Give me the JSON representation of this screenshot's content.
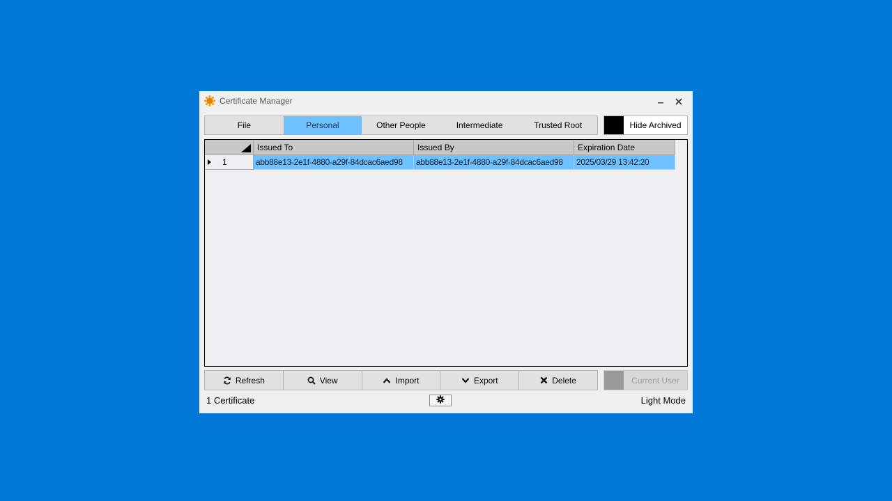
{
  "window": {
    "title": "Certificate Manager"
  },
  "tabs": [
    {
      "label": "File",
      "active": false
    },
    {
      "label": "Personal",
      "active": true
    },
    {
      "label": "Other People",
      "active": false
    },
    {
      "label": "Intermediate",
      "active": false
    },
    {
      "label": "Trusted Root",
      "active": false
    }
  ],
  "hide_archived": {
    "label": "Hide Archived"
  },
  "grid": {
    "columns": [
      "Issued To",
      "Issued By",
      "Expiration Date"
    ],
    "rows": [
      {
        "index": "1",
        "issued_to": "abb88e13-2e1f-4880-a29f-84dcac6aed98",
        "issued_by": "abb88e13-2e1f-4880-a29f-84dcac6aed98",
        "expiration": "2025/03/29 13:42:20"
      }
    ]
  },
  "actions": {
    "refresh": {
      "label": "Refresh",
      "icon": "refresh-icon"
    },
    "view": {
      "label": "View",
      "icon": "search-icon"
    },
    "import": {
      "label": "Import",
      "icon": "chevron-up-icon"
    },
    "export": {
      "label": "Export",
      "icon": "chevron-down-icon"
    },
    "delete": {
      "label": "Delete",
      "icon": "x-icon"
    }
  },
  "current_user": {
    "label": "Current User"
  },
  "status": {
    "count": "1 Certificate",
    "mode": "Light Mode"
  },
  "colors": {
    "desktop": "#0078d7",
    "selected": "#6ec0ff",
    "window": "#f0f0f0"
  }
}
